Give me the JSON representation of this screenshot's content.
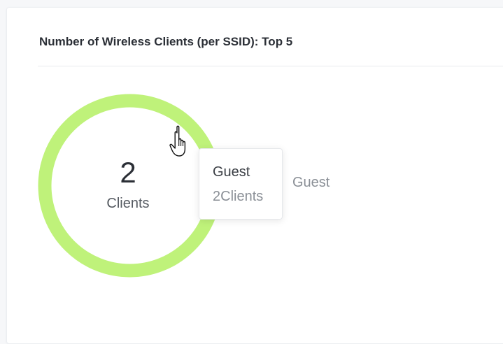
{
  "widget": {
    "title": "Number of Wireless Clients (per SSID): Top 5",
    "total_value": "2",
    "total_label": "Clients"
  },
  "tooltip": {
    "name": "Guest",
    "value": "2Clients"
  },
  "legend": {
    "items": [
      "Guest"
    ]
  },
  "colors": {
    "guest": "#bff27a"
  },
  "chart_data": {
    "type": "pie",
    "title": "Number of Wireless Clients (per SSID): Top 5",
    "categories": [
      "Guest"
    ],
    "values": [
      2
    ],
    "center_text": [
      "2",
      "Clients"
    ]
  },
  "cursor": {
    "icon": "hand-pointer-icon"
  }
}
